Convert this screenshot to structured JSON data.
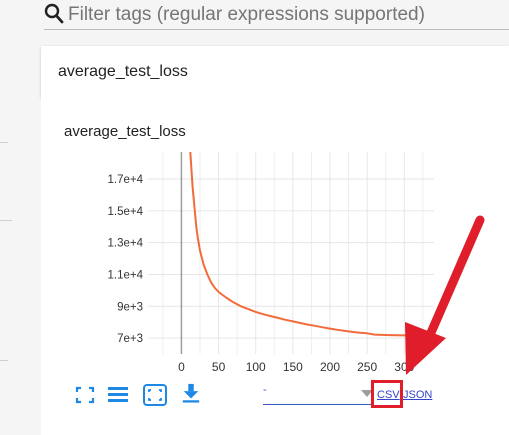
{
  "filter": {
    "placeholder": "Filter tags (regular expressions supported)",
    "icon": "search-icon"
  },
  "category": {
    "title": "average_test_loss"
  },
  "chart_card": {
    "title": "average_test_loss",
    "toolbar": {
      "fit_icon": "fit-domain-icon",
      "log_icon": "toggle-log-scale-icon",
      "expand_icon": "expand-chart-icon",
      "download_icon": "download-icon"
    },
    "download": {
      "selected_run": "-",
      "csv_label": "CSV",
      "json_label": "JSON"
    },
    "colors": {
      "line": "#f26b3a",
      "link": "#3344cc",
      "toolbar": "#1e88e5",
      "highlight": "#e01e2b"
    }
  },
  "chart_data": {
    "type": "line",
    "title": "average_test_loss",
    "xlabel": "",
    "ylabel": "",
    "xlim": [
      -45,
      340
    ],
    "ylim": [
      6000,
      18700
    ],
    "x_ticks": [
      "0",
      "50",
      "100",
      "150",
      "200",
      "250",
      "300"
    ],
    "y_ticks": [
      "7e+3",
      "9e+3",
      "1.1e+4",
      "1.3e+4",
      "1.5e+4",
      "1.7e+4"
    ],
    "grid": true,
    "series": [
      {
        "color": "#f26b3a",
        "x": [
          12,
          15,
          18,
          20,
          22,
          25,
          30,
          35,
          40,
          45,
          50,
          60,
          70,
          80,
          90,
          100,
          110,
          120,
          130,
          140,
          150,
          160,
          170,
          180,
          190,
          200,
          210,
          220,
          230,
          240,
          250,
          260,
          270,
          280,
          290,
          300,
          310
        ],
        "y": [
          18700,
          16500,
          15000,
          14000,
          13300,
          12500,
          11600,
          11000,
          10500,
          10150,
          9900,
          9550,
          9250,
          9000,
          8820,
          8650,
          8500,
          8380,
          8270,
          8150,
          8050,
          7950,
          7850,
          7770,
          7680,
          7600,
          7520,
          7450,
          7390,
          7340,
          7300,
          7220,
          7200,
          7190,
          7180,
          7170,
          7160
        ]
      }
    ]
  }
}
